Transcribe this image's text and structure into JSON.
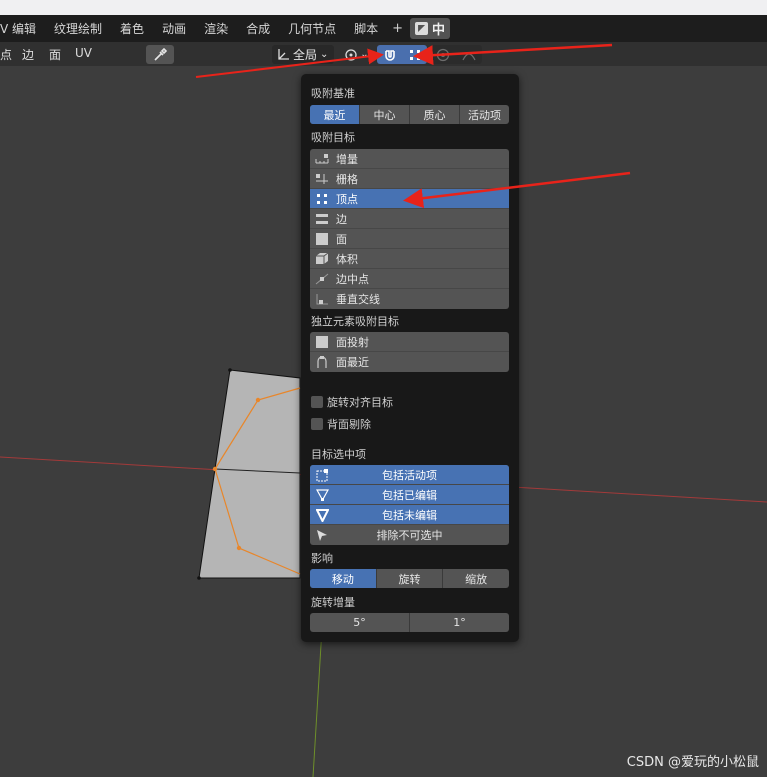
{
  "workspace_tabs": [
    "V 编辑",
    "纹理绘制",
    "着色",
    "动画",
    "渲染",
    "合成",
    "几何节点",
    "脚本"
  ],
  "workspace_plus": "+",
  "scene_label": "中",
  "header": {
    "select_modes": [
      "点",
      "边",
      "面",
      "UV"
    ],
    "orientation": "全局",
    "chevron": "⌄"
  },
  "popup": {
    "snap_base_title": "吸附基准",
    "snap_base_options": [
      {
        "label": "最近",
        "active": true
      },
      {
        "label": "中心",
        "active": false
      },
      {
        "label": "质心",
        "active": false
      },
      {
        "label": "活动项",
        "active": false
      }
    ],
    "snap_target_title": "吸附目标",
    "snap_targets": [
      {
        "label": "增量",
        "icon": "increment-icon",
        "active": false
      },
      {
        "label": "栅格",
        "icon": "grid-icon",
        "active": false
      },
      {
        "label": "顶点",
        "icon": "vertex-icon",
        "active": true
      },
      {
        "label": "边",
        "icon": "edge-icon",
        "active": false
      },
      {
        "label": "面",
        "icon": "face-icon",
        "active": false
      },
      {
        "label": "体积",
        "icon": "volume-icon",
        "active": false
      },
      {
        "label": "边中点",
        "icon": "edge-midpoint-icon",
        "active": false
      },
      {
        "label": "垂直交线",
        "icon": "perpendicular-icon",
        "active": false
      }
    ],
    "individual_title": "独立元素吸附目标",
    "individual_targets": [
      {
        "label": "面投射",
        "icon": "face-project-icon"
      },
      {
        "label": "面最近",
        "icon": "face-nearest-icon"
      }
    ],
    "rotate_align": "旋转对齐目标",
    "backface_cull": "背面剔除",
    "target_selection_title": "目标选中项",
    "target_selection": [
      {
        "label": "包括活动项",
        "icon": "include-active-icon",
        "active": true
      },
      {
        "label": "包括已编辑",
        "icon": "include-edited-icon",
        "active": true
      },
      {
        "label": "包括未编辑",
        "icon": "include-nonedited-icon",
        "active": true
      },
      {
        "label": "排除不可选中",
        "icon": "exclude-nonselectable-icon",
        "active": false
      }
    ],
    "affect_title": "影响",
    "affect_options": [
      {
        "label": "移动",
        "active": true
      },
      {
        "label": "旋转",
        "active": false
      },
      {
        "label": "缩放",
        "active": false
      }
    ],
    "rotation_increment_title": "旋转增量",
    "rotation_increments": [
      "5°",
      "1°"
    ]
  },
  "watermark": "CSDN @爱玩的小松鼠",
  "colors": {
    "accent": "#4772b3",
    "popup_bg": "#181818",
    "button": "#545454",
    "viewport": "#3d3d3d",
    "annotation_arrow": "#e8231a",
    "x_axis": "#a33a3a",
    "y_axis": "#6e8f2a",
    "uv_outline": "#e8862a"
  }
}
